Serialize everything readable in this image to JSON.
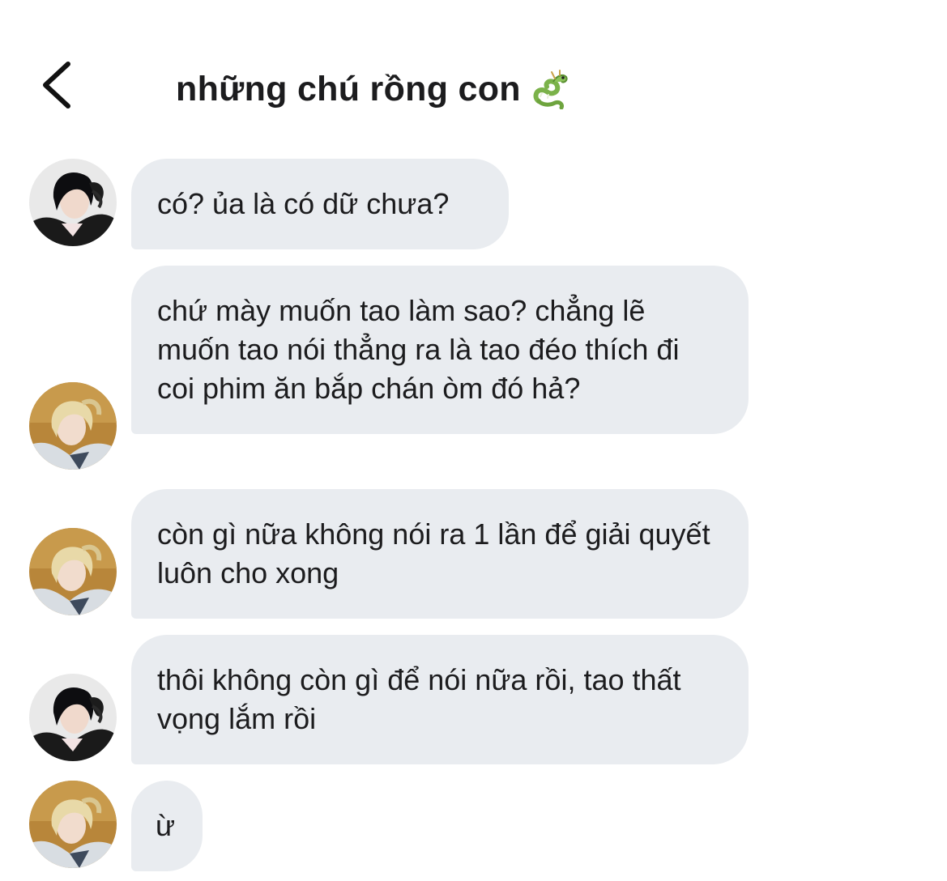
{
  "header": {
    "title": "những chú rồng con",
    "title_icon": "dragon-emoji-icon",
    "back_icon": "chevron-left-icon"
  },
  "colors": {
    "bubble_bg": "#e9ecf0",
    "text": "#1c1c1e",
    "background": "#ffffff"
  },
  "messages": [
    {
      "sender": "dark-haired-member",
      "avatar_icon": "avatar-dark-hair",
      "text": "có? ủa là có dữ chưa?"
    },
    {
      "sender": "blonde-member",
      "avatar_icon": "avatar-blonde-hair",
      "text": "chứ mày muốn tao làm sao? chẳng lẽ muốn tao nói thẳng ra là tao đéo thích đi coi phim ăn bắp chán òm đó hả?"
    },
    {
      "sender": "blonde-member",
      "avatar_icon": "avatar-blonde-hair",
      "text": "còn gì nữa không nói ra 1 lần để giải quyết luôn cho xong"
    },
    {
      "sender": "dark-haired-member",
      "avatar_icon": "avatar-dark-hair",
      "text": "thôi không còn gì để nói nữa rồi, tao thất vọng lắm rồi"
    },
    {
      "sender": "blonde-member",
      "avatar_icon": "avatar-blonde-hair",
      "text": "ừ"
    }
  ]
}
